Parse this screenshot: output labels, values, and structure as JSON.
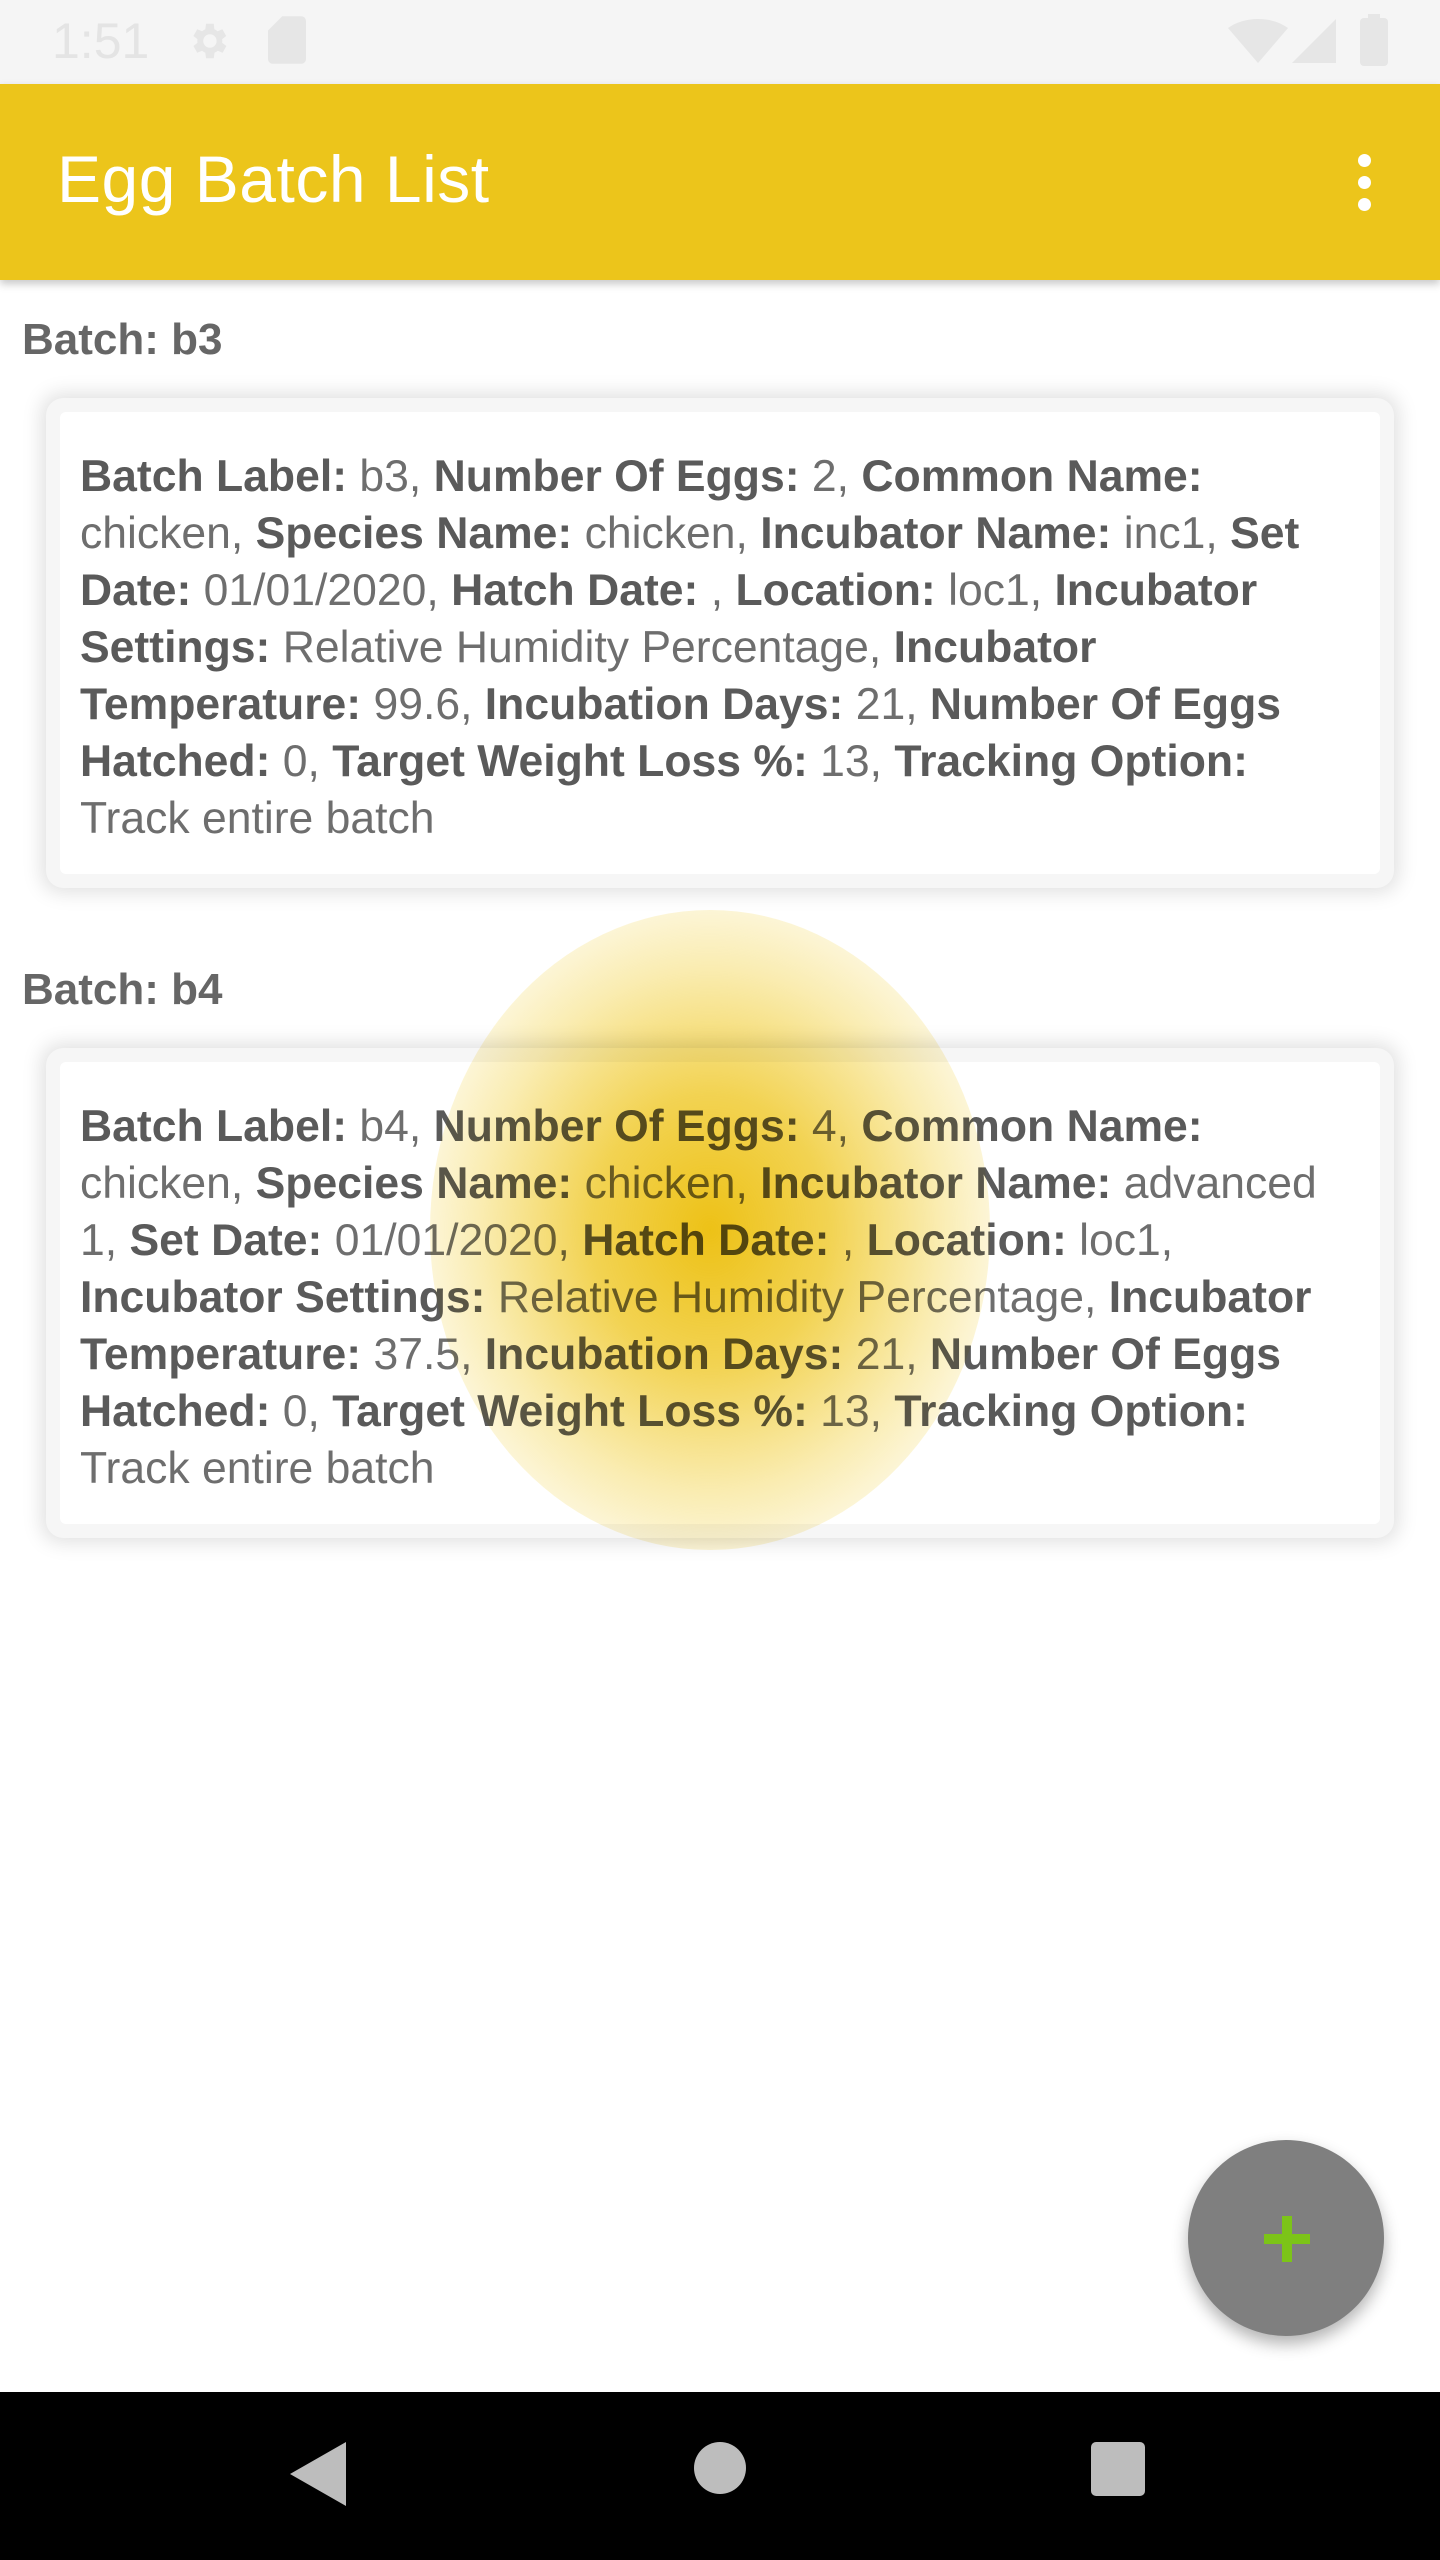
{
  "status_bar": {
    "time": "1:51",
    "icons": [
      "gear-icon",
      "sd-card-icon",
      "wifi-icon",
      "cell-signal-icon",
      "battery-icon"
    ]
  },
  "app_bar": {
    "title": "Egg Batch List",
    "menu_icon": "more-vert-icon",
    "background_color": "#ecc51b"
  },
  "batches": [
    {
      "header": "Batch: b3",
      "fields": [
        {
          "label": "Batch Label:",
          "value": " b3, "
        },
        {
          "label": "Number Of Eggs:",
          "value": " 2, "
        },
        {
          "label": "Common Name:",
          "value": " chicken, "
        },
        {
          "label": "Species Name:",
          "value": " chicken, "
        },
        {
          "label": "Incubator Name:",
          "value": " inc1, "
        },
        {
          "label": "Set Date:",
          "value": " 01/01/2020, "
        },
        {
          "label": "Hatch Date:",
          "value": " , "
        },
        {
          "label": "Location:",
          "value": " loc1, "
        },
        {
          "label": "Incubator Settings:",
          "value": " Relative Humidity Percentage, "
        },
        {
          "label": "Incubator Temperature:",
          "value": " 99.6, "
        },
        {
          "label": "Incubation Days:",
          "value": " 21, "
        },
        {
          "label": "Number Of Eggs Hatched:",
          "value": " 0, "
        },
        {
          "label": "Target Weight Loss %:",
          "value": " 13, "
        },
        {
          "label": "Tracking Option:",
          "value": " Track entire batch"
        }
      ]
    },
    {
      "header": "Batch: b4",
      "fields": [
        {
          "label": "Batch Label:",
          "value": " b4, "
        },
        {
          "label": "Number Of Eggs:",
          "value": " 4, "
        },
        {
          "label": "Common Name:",
          "value": " chicken, "
        },
        {
          "label": "Species Name:",
          "value": " chicken, "
        },
        {
          "label": "Incubator Name:",
          "value": " advanced 1, "
        },
        {
          "label": "Set Date:",
          "value": " 01/01/2020, "
        },
        {
          "label": "Hatch Date:",
          "value": " , "
        },
        {
          "label": "Location:",
          "value": " loc1, "
        },
        {
          "label": "Incubator Settings:",
          "value": " Relative Humidity Percentage, "
        },
        {
          "label": "Incubator Temperature:",
          "value": " 37.5, "
        },
        {
          "label": "Incubation Days:",
          "value": " 21, "
        },
        {
          "label": "Number Of Eggs Hatched:",
          "value": " 0, "
        },
        {
          "label": "Target Weight Loss %:",
          "value": " 13, "
        },
        {
          "label": "Tracking Option:",
          "value": " Track entire batch"
        }
      ]
    }
  ],
  "fab": {
    "icon": "plus-icon",
    "icon_color": "#7cc418",
    "background_color": "#7f7f7f"
  },
  "nav_bar": {
    "icons": [
      "back-icon",
      "home-icon",
      "recents-icon"
    ]
  }
}
